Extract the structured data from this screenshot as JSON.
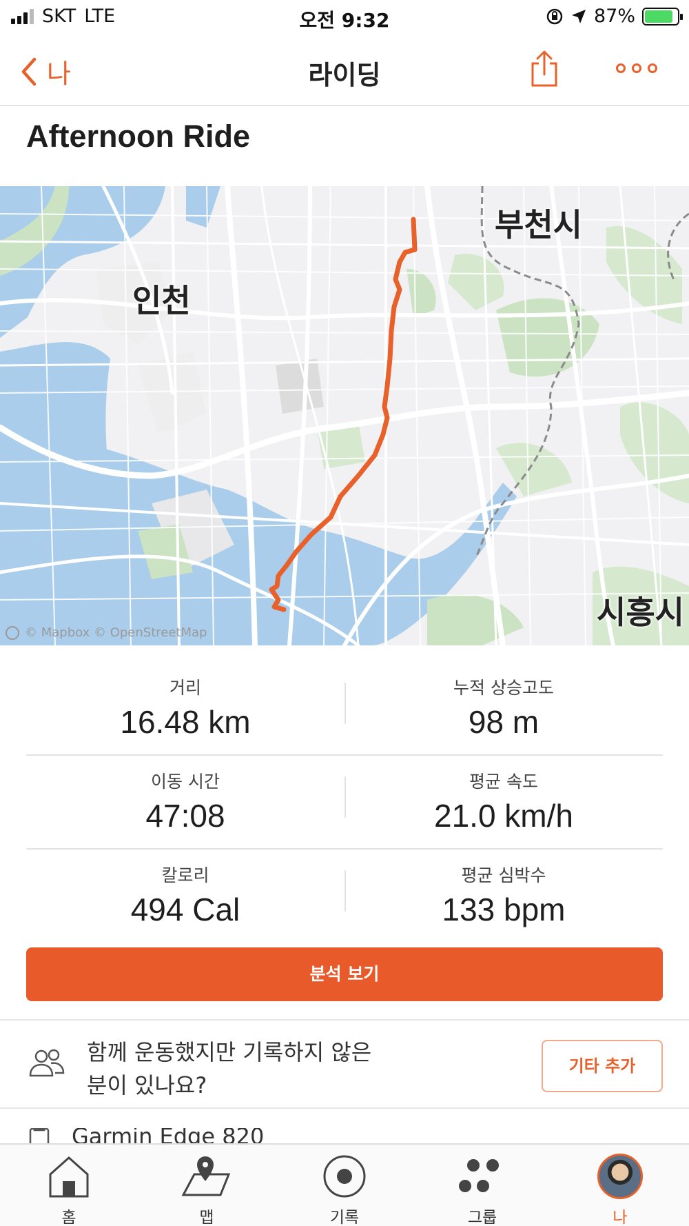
{
  "status_bar": {
    "carrier": "SKT",
    "network": "LTE",
    "time": "오전 9:32",
    "battery": "87%",
    "battery_level": 0.87
  },
  "nav": {
    "back_label": "나",
    "title": "라이딩"
  },
  "activity": {
    "title": "Afternoon Ride"
  },
  "map": {
    "labels": {
      "bucheon": "부천시",
      "incheon": "인천",
      "siheung": "시흥시"
    },
    "attribution": "© Mapbox © OpenStreetMap",
    "route_color": "#e8602a"
  },
  "stats": [
    {
      "left_label": "거리",
      "left_value": "16.48 km",
      "right_label": "누적 상승고도",
      "right_value": "98 m"
    },
    {
      "left_label": "이동 시간",
      "left_value": "47:08",
      "right_label": "평균 속도",
      "right_value": "21.0 km/h"
    },
    {
      "left_label": "칼로리",
      "left_value": "494 Cal",
      "right_label": "평균 심박수",
      "right_value": "133 bpm"
    }
  ],
  "analysis_button": "분석 보기",
  "add_others": {
    "line1": "함께 운동했지만 기록하지 않은",
    "line2": "분이 있나요?",
    "button": "기타 추가"
  },
  "gear": {
    "name": "Garmin Edge 820"
  },
  "tabs": [
    {
      "label": "홈",
      "icon": "home-icon"
    },
    {
      "label": "맵",
      "icon": "map-icon"
    },
    {
      "label": "기록",
      "icon": "record-icon"
    },
    {
      "label": "그룹",
      "icon": "groups-icon"
    },
    {
      "label": "나",
      "icon": "avatar",
      "active": true
    }
  ],
  "colors": {
    "accent": "#e8602a",
    "button": "#e95a2a",
    "water": "#a9cdea",
    "park": "#cbe3c3"
  }
}
